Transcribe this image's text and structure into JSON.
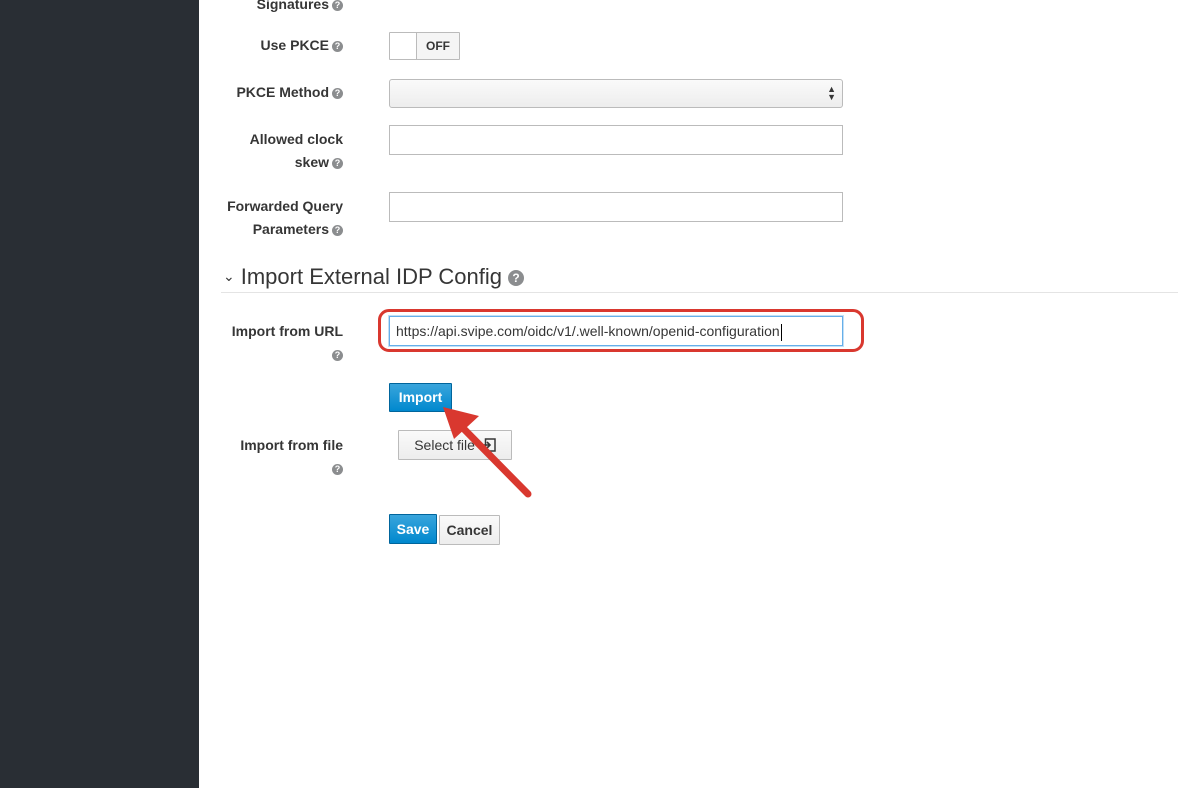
{
  "form": {
    "signatures_label": "Signatures",
    "use_pkce_label": "Use PKCE",
    "use_pkce_state": "OFF",
    "pkce_method_label": "PKCE Method",
    "pkce_method_value": "",
    "clock_skew_label_line1": "Allowed clock",
    "clock_skew_label_line2": "skew",
    "clock_skew_value": "",
    "forwarded_label_line1": "Forwarded Query",
    "forwarded_label_line2": "Parameters",
    "forwarded_value": ""
  },
  "import_section": {
    "title": "Import External IDP Config",
    "url_label": "Import from URL",
    "url_value": "https://api.svipe.com/oidc/v1/.well-known/openid-configuration",
    "import_button": "Import",
    "file_label": "Import from file",
    "select_file_button": "Select file"
  },
  "actions": {
    "save": "Save",
    "cancel": "Cancel"
  },
  "icons": {
    "help": "help-circle-icon",
    "chevron": "chevron-down-icon",
    "upload": "file-import-icon",
    "select_caret": "select-caret-icon"
  },
  "colors": {
    "sidebar": "#292e34",
    "primary": "#0088ce",
    "annotation": "#d9382f"
  }
}
